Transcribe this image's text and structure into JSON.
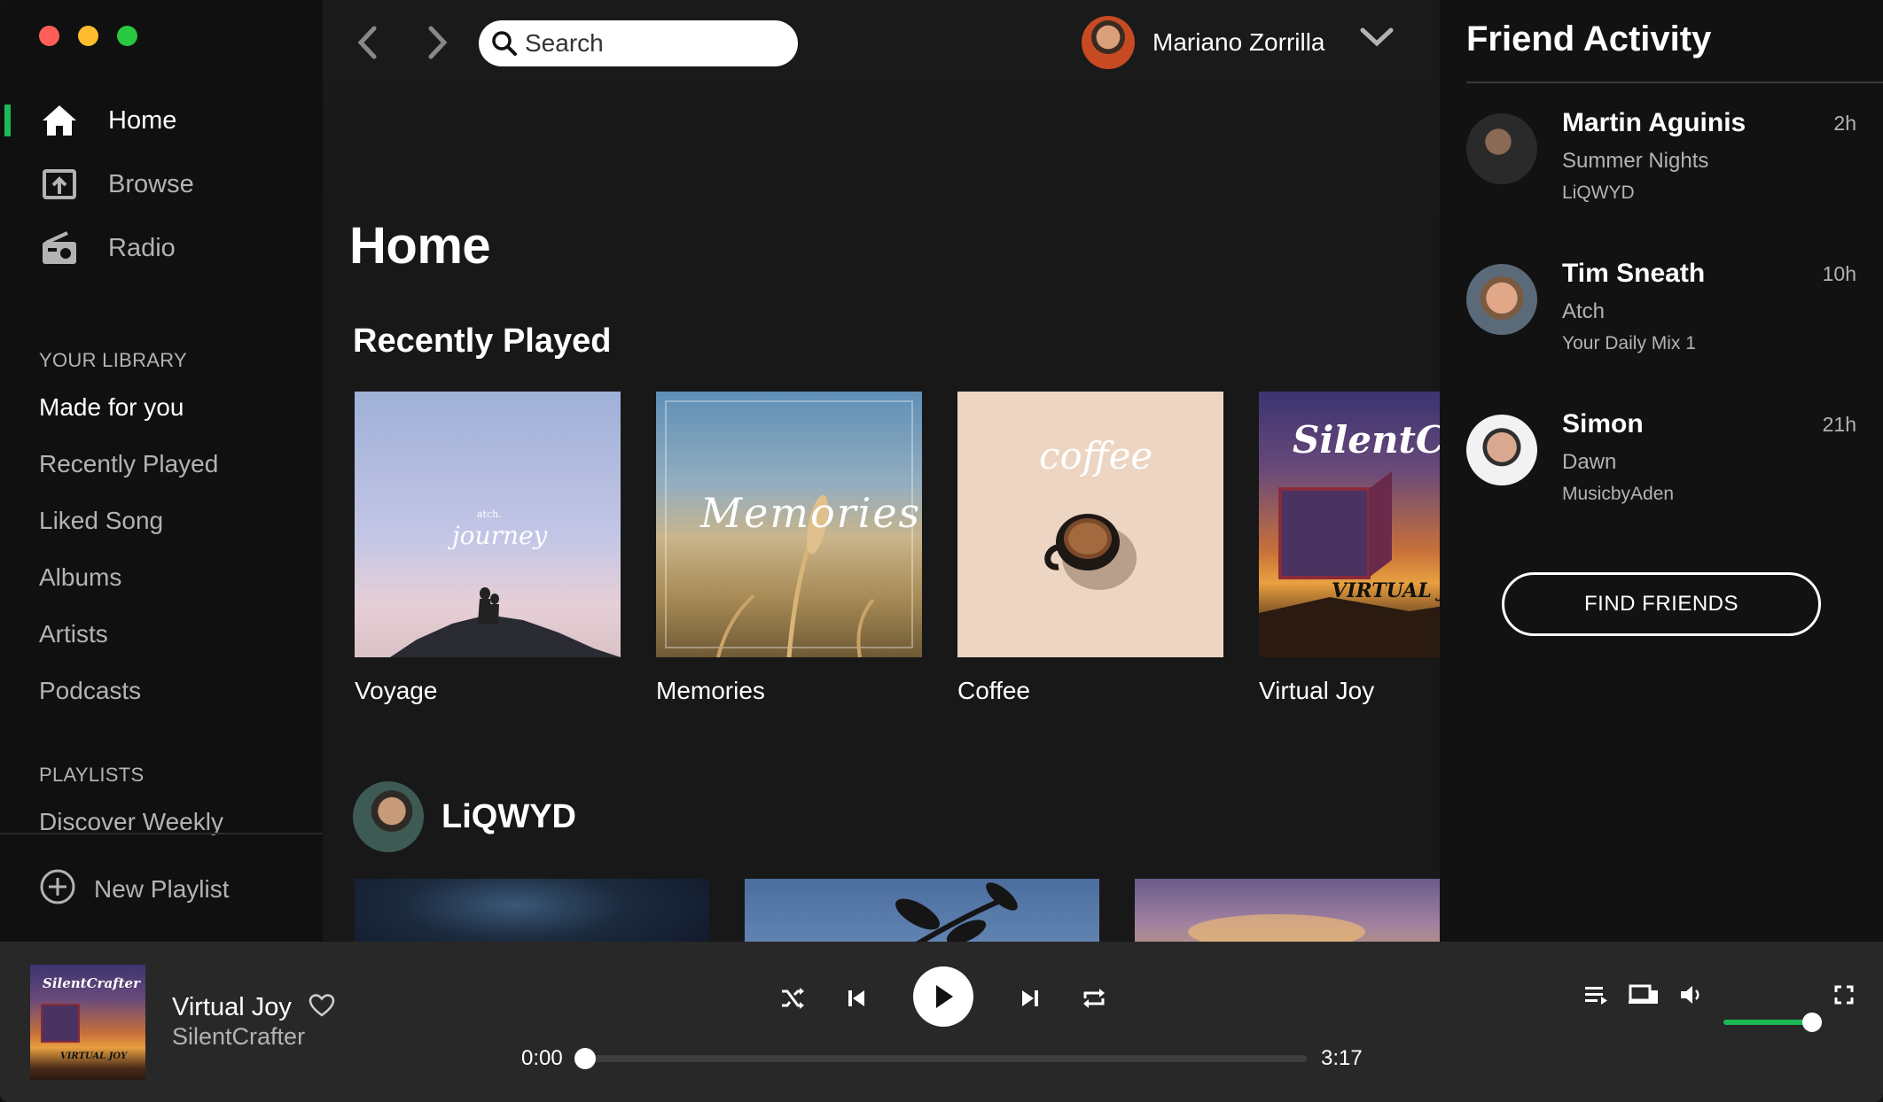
{
  "window": {
    "traffic_colors": [
      "#ff5f57",
      "#febc2e",
      "#28c840"
    ]
  },
  "sidebar": {
    "nav": [
      {
        "label": "Home",
        "icon": "home-icon",
        "active": true
      },
      {
        "label": "Browse",
        "icon": "browse-icon",
        "active": false
      },
      {
        "label": "Radio",
        "icon": "radio-icon",
        "active": false
      }
    ],
    "library_heading": "YOUR LIBRARY",
    "library": [
      "Made for you",
      "Recently Played",
      "Liked Song",
      "Albums",
      "Artists",
      "Podcasts"
    ],
    "playlists_heading": "PLAYLISTS",
    "playlists": [
      "Discover Weekly"
    ],
    "new_playlist_label": "New Playlist"
  },
  "topbar": {
    "search_placeholder": "Search",
    "user_name": "Mariano Zorrilla"
  },
  "main": {
    "title": "Home",
    "recently_played_title": "Recently Played",
    "recently_played": [
      {
        "title": "Voyage",
        "cover_text": "journey",
        "cover_small": "atch."
      },
      {
        "title": "Memories",
        "cover_text": "Memories"
      },
      {
        "title": "Coffee",
        "cover_text": "coffee"
      },
      {
        "title": "Virtual Joy",
        "cover_text": "SilentCra",
        "cover_sub": "VIRTUAL JO"
      }
    ],
    "artist_section": {
      "name": "LiQWYD"
    }
  },
  "friend_activity": {
    "title": "Friend Activity",
    "friends": [
      {
        "name": "Martin Aguinis",
        "time": "2h",
        "track": "Summer Nights",
        "artist": "LiQWYD"
      },
      {
        "name": "Tim Sneath",
        "time": "10h",
        "track": "Atch",
        "artist": "Your Daily Mix 1"
      },
      {
        "name": "Simon",
        "time": "21h",
        "track": "Dawn",
        "artist": "MusicbyAden"
      }
    ],
    "find_friends_label": "FIND FRIENDS"
  },
  "player": {
    "title": "Virtual Joy",
    "artist": "SilentCrafter",
    "cover_text": "SilentCrafter",
    "cover_sub": "VIRTUAL JOY",
    "elapsed": "0:00",
    "duration": "3:17",
    "progress_fraction": 0,
    "volume_fraction": 1.0,
    "accent_color": "#1db954"
  }
}
